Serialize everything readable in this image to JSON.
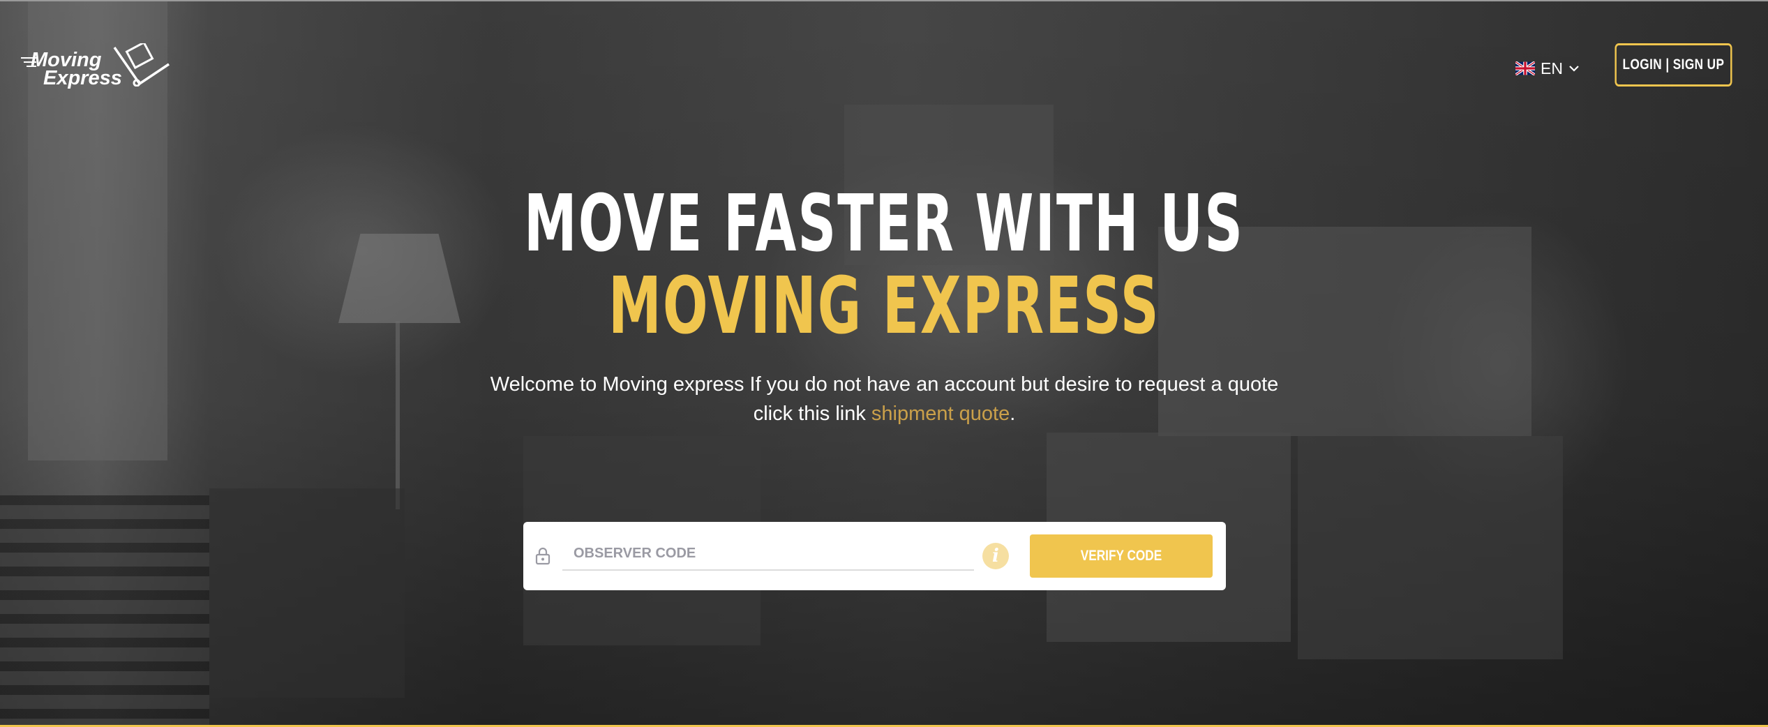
{
  "brand": {
    "logo_line1": "Moving",
    "logo_line2": "Express",
    "accent_color": "#f0c54e"
  },
  "header": {
    "language": "EN",
    "language_icon": "uk-flag-icon",
    "login_label": "LOGIN | SIGN UP"
  },
  "hero": {
    "title_line1": "MOVE FASTER WITH US",
    "title_line2": "MOVING EXPRESS",
    "lead_text": "Welcome to Moving express If you do not have an account but desire to request a quote click this link",
    "lead_link": "shipment quote",
    "lead_end": "."
  },
  "form": {
    "code_placeholder": "OBSERVER CODE",
    "code_value": "",
    "info_icon": "i",
    "verify_label": "VERIFY CODE"
  }
}
